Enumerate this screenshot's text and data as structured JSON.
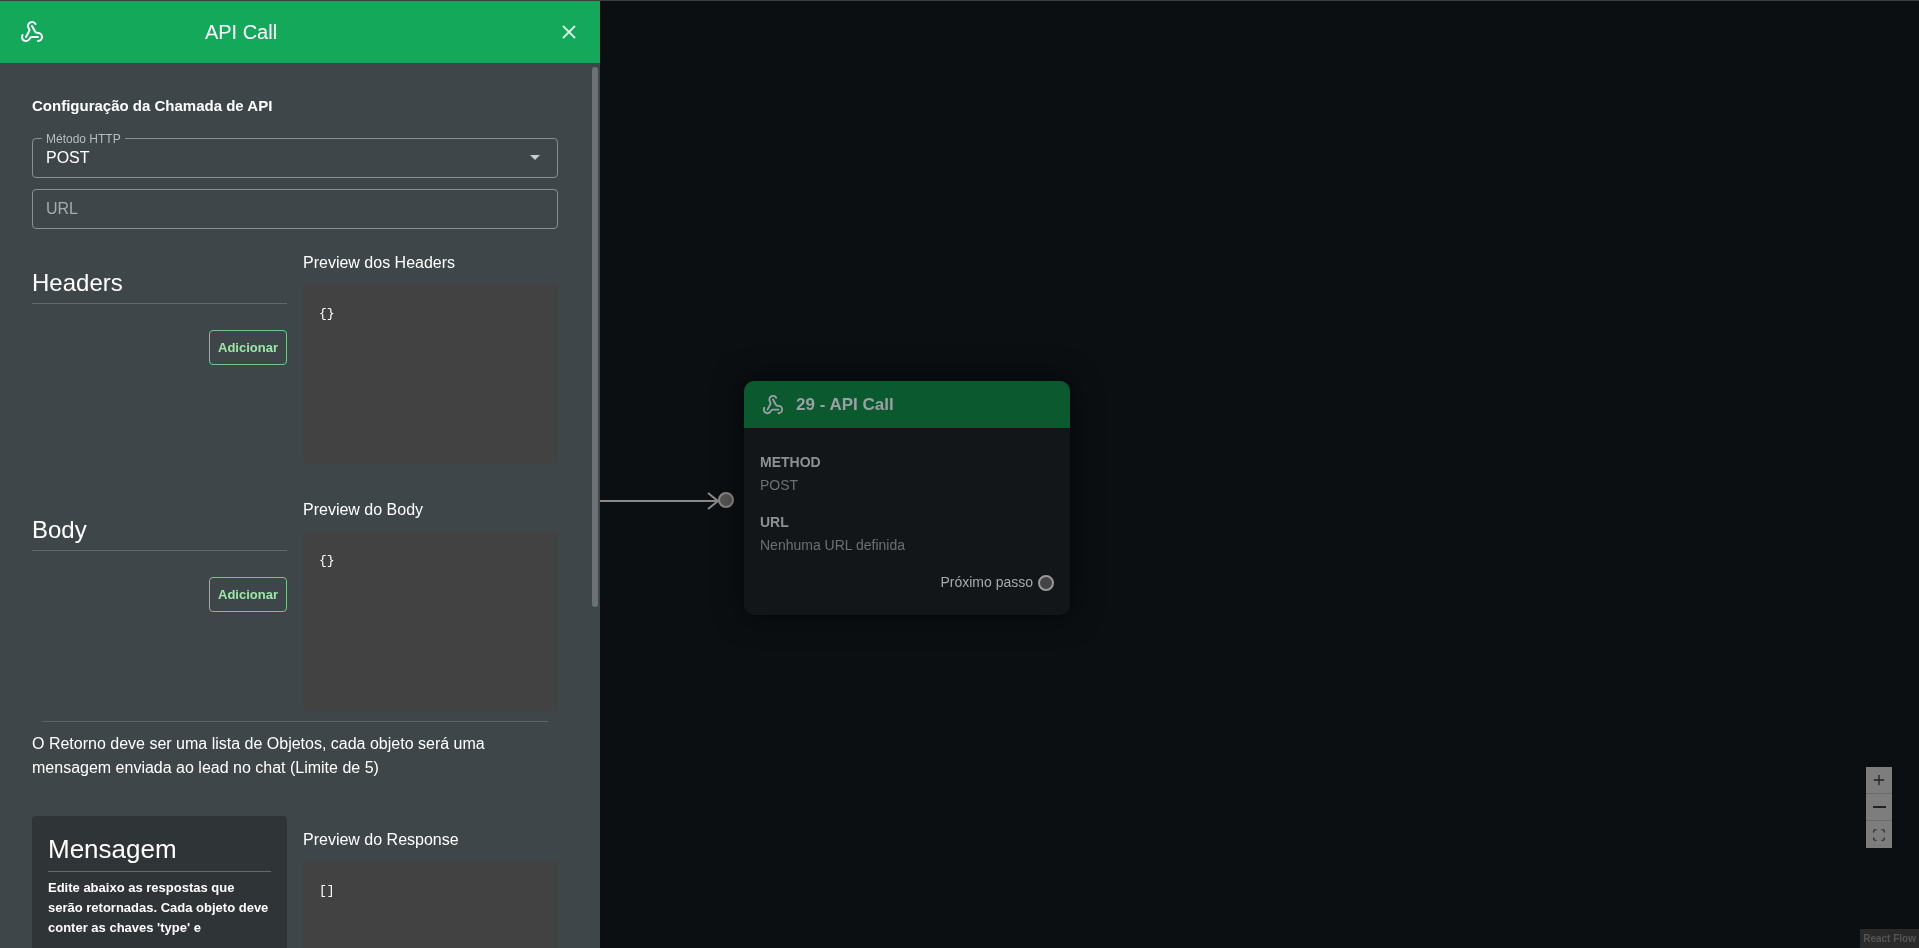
{
  "panel": {
    "title": "API Call",
    "section_title": "Configuração da Chamada de API",
    "method_field": {
      "label": "Método HTTP",
      "value": "POST"
    },
    "url_field": {
      "placeholder": "URL"
    },
    "sections": [
      {
        "title": "Headers",
        "button": "Adicionar",
        "preview_title": "Preview dos Headers",
        "preview": "{}"
      },
      {
        "title": "Body",
        "button": "Adicionar",
        "preview_title": "Preview do Body",
        "preview": "{}"
      }
    ],
    "note": "O Retorno deve ser uma lista de Objetos, cada objeto será uma mensagem enviada ao lead no chat (Limite de 5)",
    "message_card": {
      "title": "Mensagem",
      "text": "Edite abaixo as respostas que serão retornadas. Cada objeto deve conter as chaves 'type' e"
    },
    "response": {
      "preview_title": "Preview do Response",
      "preview": "[]"
    }
  },
  "node": {
    "title": "29 - API Call",
    "fields": [
      {
        "label": "METHOD",
        "value": "POST"
      },
      {
        "label": "URL",
        "value": "Nenhuma URL definida"
      }
    ],
    "output_label": "Próximo passo"
  },
  "attribution": "React Flow"
}
